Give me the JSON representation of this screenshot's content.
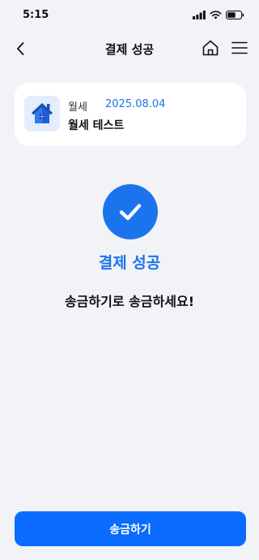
{
  "status_bar": {
    "time": "5:15",
    "icons": [
      "cellular-signal-icon",
      "wifi-icon",
      "battery-icon"
    ]
  },
  "nav": {
    "title": "결제 성공",
    "back_icon": "chevron-left-icon",
    "home_icon": "home-icon",
    "menu_icon": "hamburger-menu-icon"
  },
  "card": {
    "icon": "house-icon",
    "type": "월세",
    "date": "2025.08.04",
    "name": "월세 테스트"
  },
  "result": {
    "icon": "checkmark-icon",
    "title": "결제 성공",
    "message": "송금하기로 송금하세요!"
  },
  "action": {
    "label": "송금하기"
  },
  "colors": {
    "accent": "#1b74ee",
    "button": "#0a6cff",
    "background": "#f2f3f6",
    "card": "#ffffff",
    "date_text": "#1a73e8"
  }
}
